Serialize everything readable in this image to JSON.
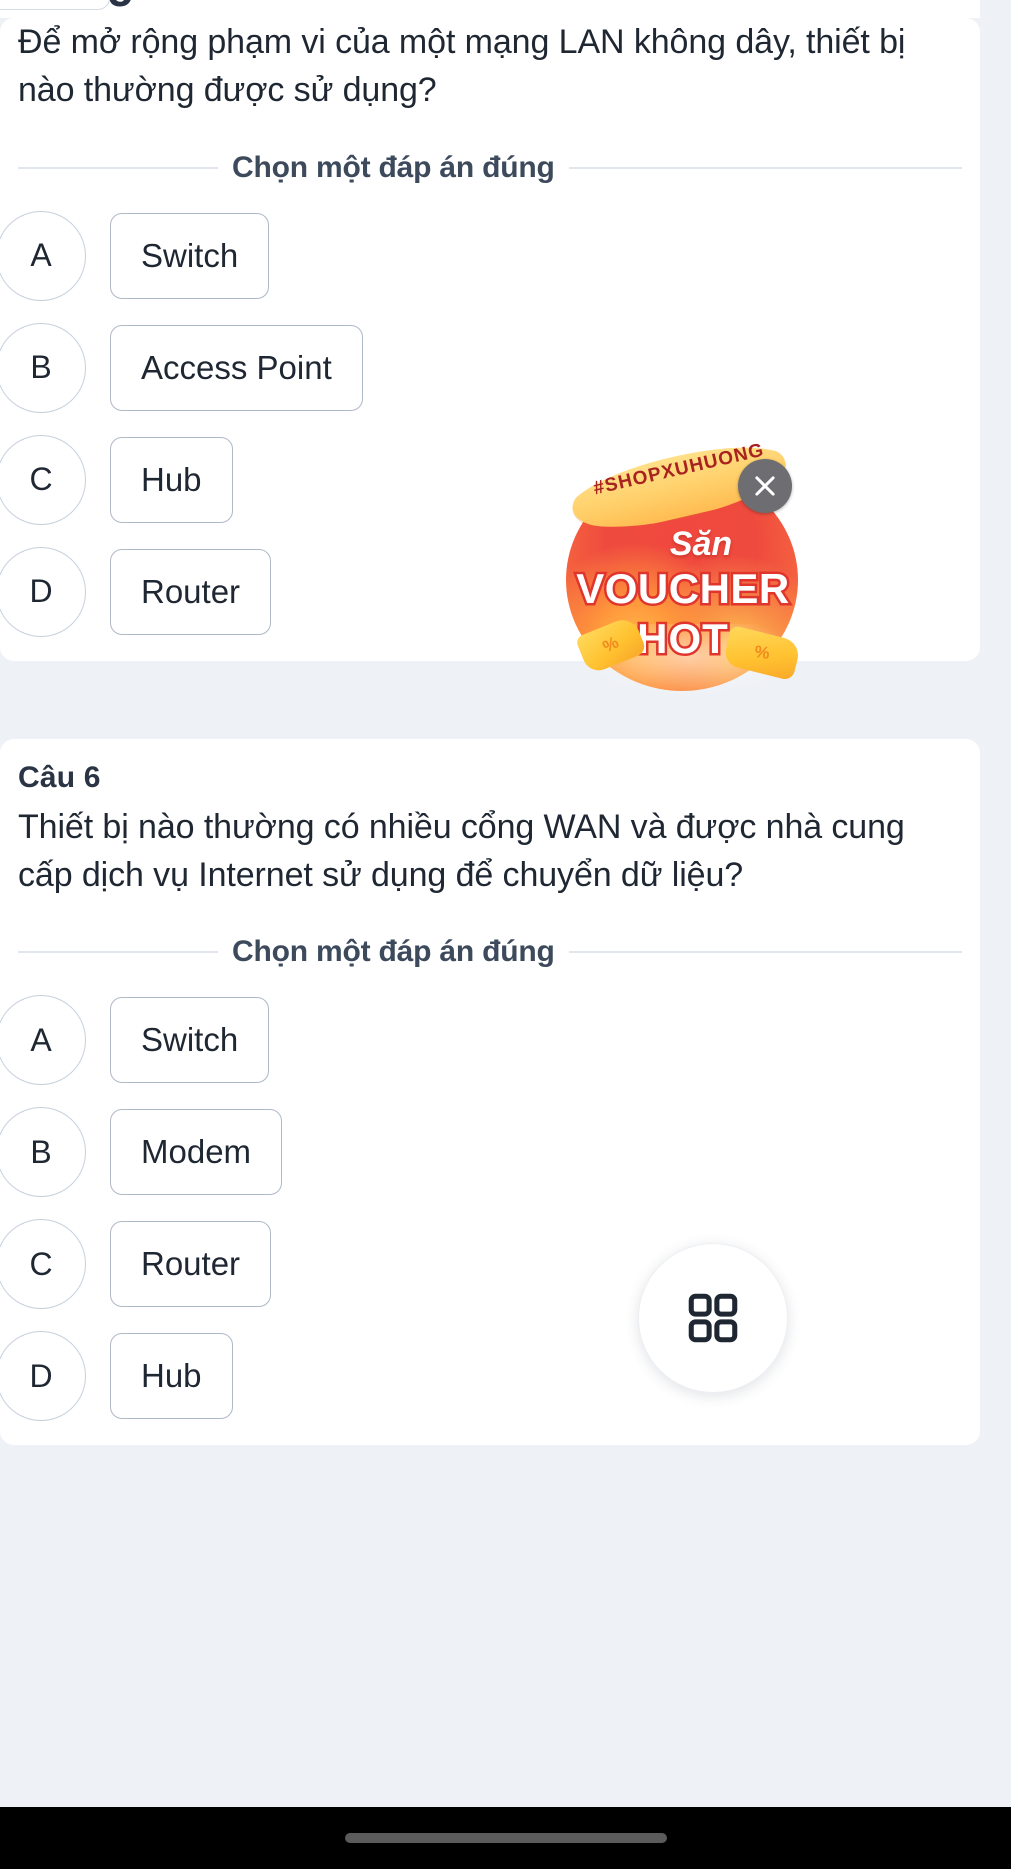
{
  "app": {
    "background_color": "#eef1f6",
    "card_color": "#ffffff",
    "text_color": "#1f2733"
  },
  "questions": [
    {
      "number_label": "",
      "text": "Để mở rộng phạm vi của một mạng LAN không dây, thiết bị nào thường được sử dụng?",
      "prompt": "Chọn một đáp án đúng",
      "options": [
        {
          "letter": "A",
          "label": "Switch"
        },
        {
          "letter": "B",
          "label": "Access Point"
        },
        {
          "letter": "C",
          "label": "Hub"
        },
        {
          "letter": "D",
          "label": "Router"
        }
      ]
    },
    {
      "number_label": "Câu 6",
      "text": "Thiết bị nào thường có nhiều cổng WAN và được nhà cung cấp dịch vụ Internet sử dụng để chuyển dữ liệu?",
      "prompt": "Chọn một đáp án đúng",
      "options": [
        {
          "letter": "A",
          "label": "Switch"
        },
        {
          "letter": "B",
          "label": "Modem"
        },
        {
          "letter": "C",
          "label": "Router"
        },
        {
          "letter": "D",
          "label": "Hub"
        }
      ]
    }
  ],
  "ad": {
    "ribbon_text": "#SHOPXUHUONG",
    "line1": "Săn",
    "line2": "VOUCHER",
    "line3": "HOT",
    "close_icon": "close-icon",
    "percent_symbol": "%",
    "colors": {
      "blob_red": "#ef4a3e",
      "blob_orange": "#fb8a42",
      "ribbon_yellow": "#ffd06a",
      "ribbon_text": "#a8231f",
      "close_bg": "#6e6e72"
    }
  },
  "fab": {
    "icon": "grid-2x2-icon",
    "icon_color": "#1f2733"
  },
  "system": {
    "home_indicator": "home-indicator"
  }
}
